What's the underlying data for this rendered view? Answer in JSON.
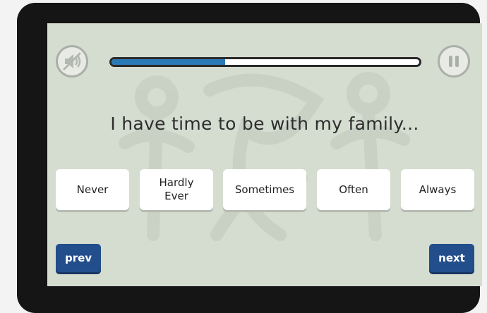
{
  "progress": {
    "fraction": 0.37
  },
  "question": {
    "text": "I have time to be with my family..."
  },
  "answers": [
    {
      "label": "Never"
    },
    {
      "label": "Hardly\nEver"
    },
    {
      "label": "Sometimes"
    },
    {
      "label": "Often"
    },
    {
      "label": "Always"
    }
  ],
  "nav": {
    "prev_label": "prev",
    "next_label": "next"
  },
  "icons": {
    "sound": "speaker-muted-icon",
    "pause": "pause-icon"
  },
  "colors": {
    "progress_fill": "#2a7ab8",
    "nav_button": "#234e8c",
    "screen_background": "#d5dcd0"
  }
}
